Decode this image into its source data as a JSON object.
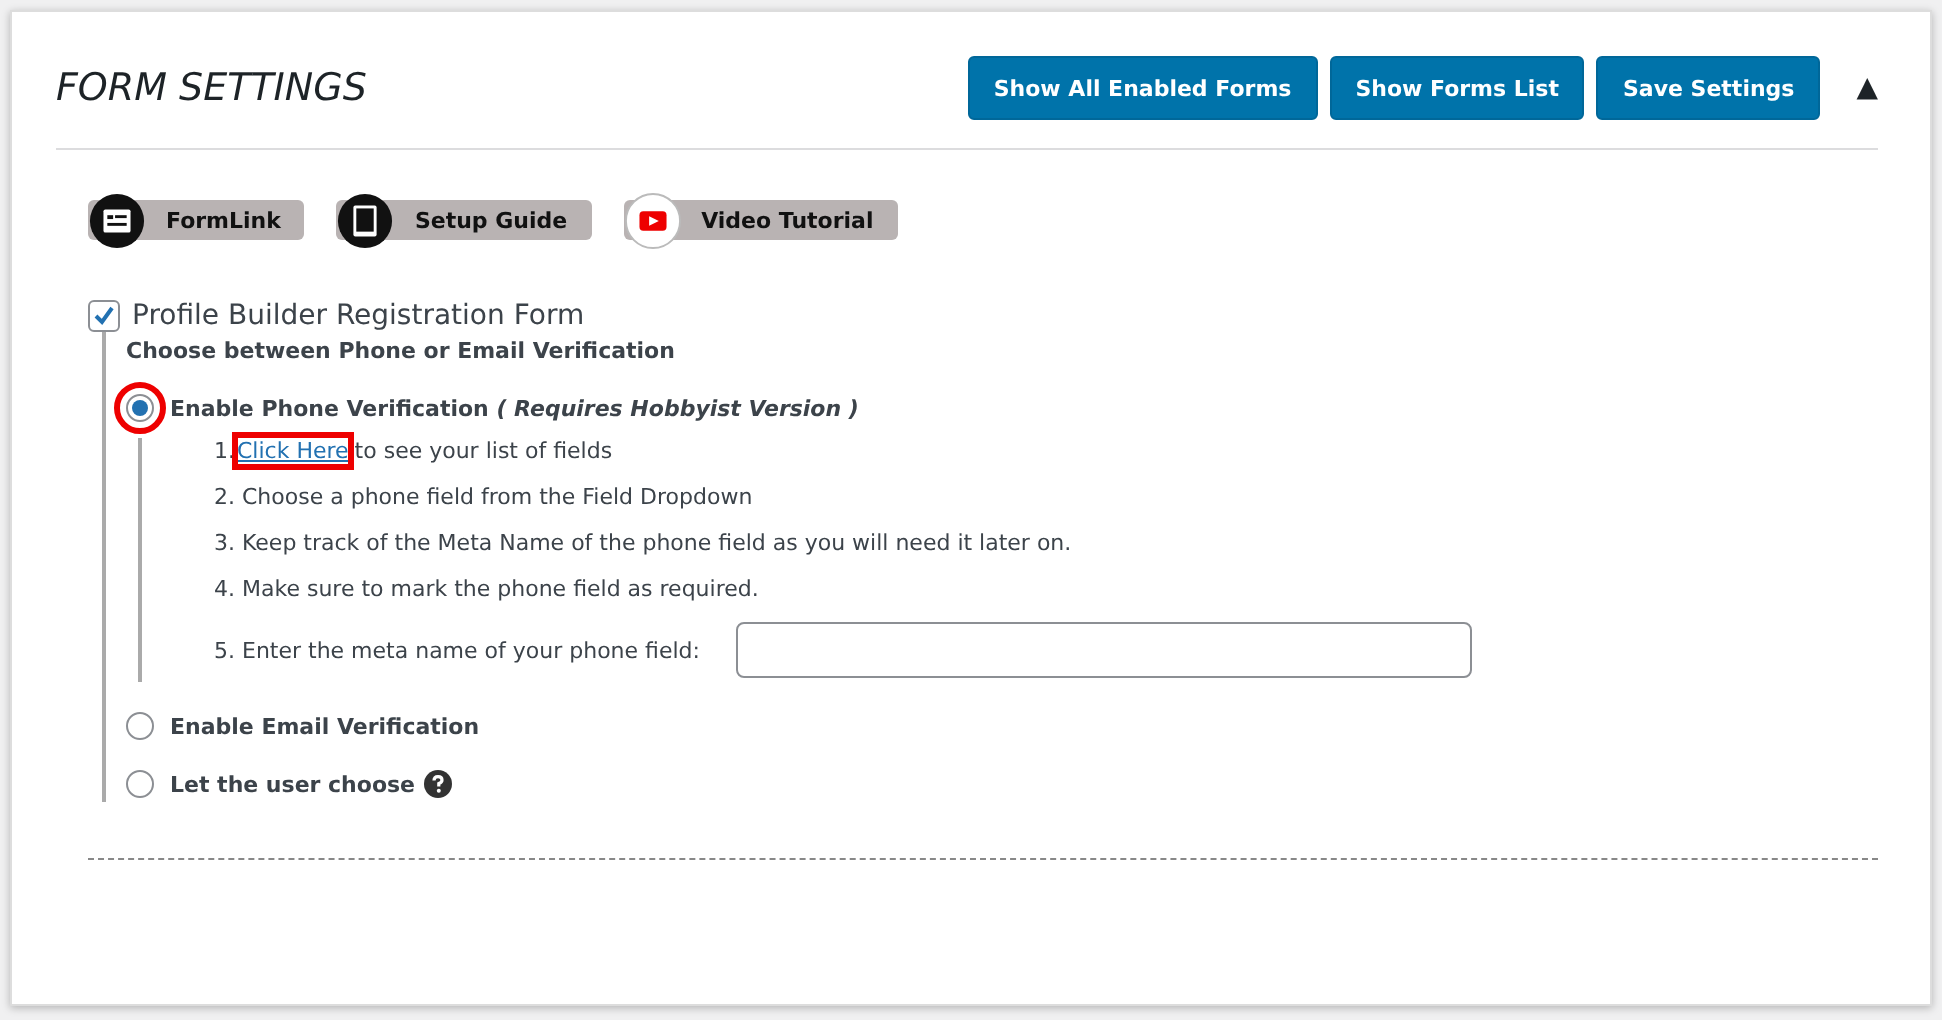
{
  "header": {
    "title": "FORM SETTINGS",
    "buttons": [
      "Show All Enabled Forms",
      "Show Forms List",
      "Save Settings"
    ],
    "collapse_icon": "▲"
  },
  "quick_links": [
    {
      "kind": "formlink",
      "label": "FormLink"
    },
    {
      "kind": "guide",
      "label": "Setup Guide"
    },
    {
      "kind": "video",
      "label": "Video Tutorial"
    }
  ],
  "form": {
    "label": "Profile Builder Registration Form",
    "checked": true,
    "subtitle": "Choose between Phone or Email Verification",
    "options": [
      {
        "label": "Enable Phone Verification",
        "note": "( Requires Hobbyist Version )",
        "selected": true,
        "highlighted": true,
        "help": false,
        "steps": [
          {
            "kind": "link",
            "prefix": "1.",
            "link": "Click Here",
            "link_highlighted": true,
            "suffix": "to see your list of fields"
          },
          {
            "kind": "text",
            "text": "2. Choose a phone field from the Field Dropdown"
          },
          {
            "kind": "text",
            "text": "3. Keep track of the Meta Name of the phone field as you will need it later on."
          },
          {
            "kind": "text",
            "text": "4. Make sure to mark the phone field as required."
          },
          {
            "kind": "input",
            "text": "5. Enter the meta name of your phone field:"
          }
        ]
      },
      {
        "label": "Enable Email Verification",
        "selected": false,
        "highlighted": false,
        "help": false
      },
      {
        "label": "Let the user choose",
        "selected": false,
        "highlighted": false,
        "help": true
      }
    ]
  }
}
